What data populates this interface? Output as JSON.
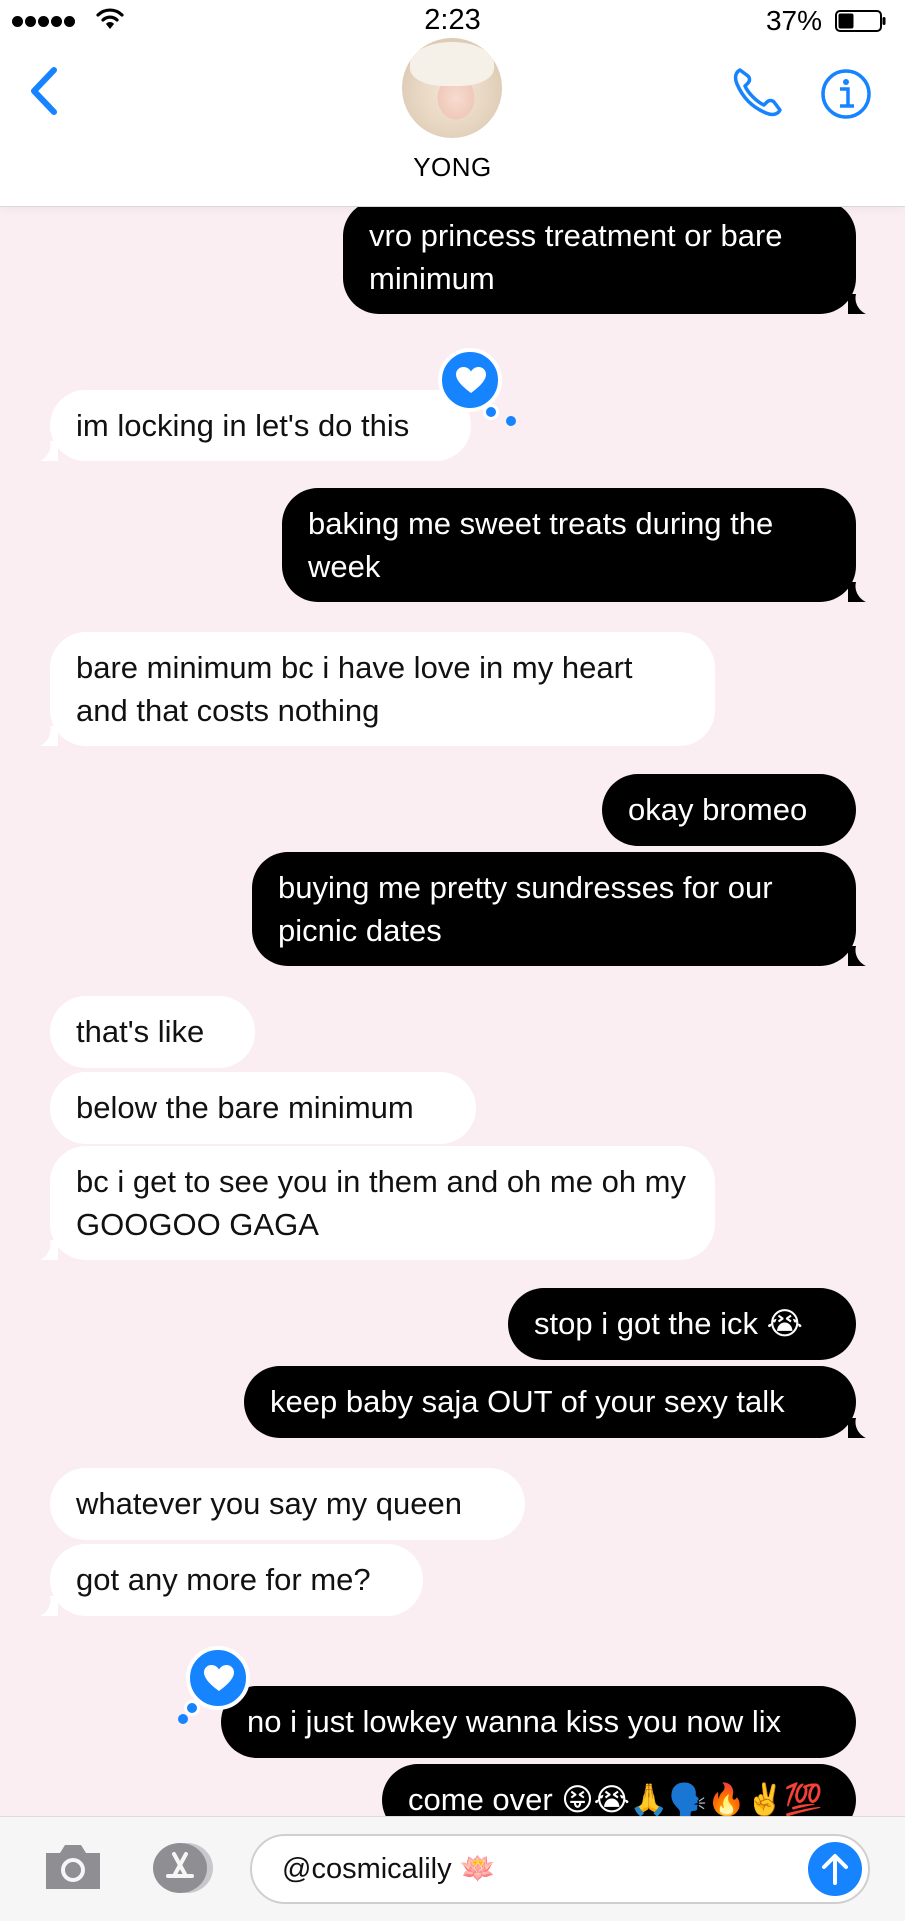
{
  "status_bar": {
    "time": "2:23",
    "battery": "37%"
  },
  "header": {
    "contact_name": "YONG"
  },
  "messages": [
    {
      "from": "me",
      "text": "vro princess treatment or bare minimum"
    },
    {
      "from": "them",
      "text": "im locking in let's do this",
      "tapback": "heart-icon"
    },
    {
      "from": "me",
      "text": "baking me sweet treats during the week"
    },
    {
      "from": "them",
      "text": "bare minimum bc i have love in my heart and that costs nothing"
    },
    {
      "from": "me",
      "text": "okay bromeo"
    },
    {
      "from": "me",
      "text": "buying me pretty sundresses for our picnic dates"
    },
    {
      "from": "them",
      "text": "that's like"
    },
    {
      "from": "them",
      "text": "below the bare minimum"
    },
    {
      "from": "them",
      "text": "bc i get to see you in them and oh me oh my GOOGOO GAGA"
    },
    {
      "from": "me",
      "text": "stop i got the ick 😭"
    },
    {
      "from": "me",
      "text": "keep baby saja OUT of your sexy talk"
    },
    {
      "from": "them",
      "text": "whatever you say my queen"
    },
    {
      "from": "them",
      "text": "got any more for me?"
    },
    {
      "from": "me",
      "text": "no i just lowkey wanna kiss you now lix",
      "tapback": "heart-icon"
    },
    {
      "from": "me",
      "text": "come over 😝😭🙏🗣️🔥✌️💯"
    }
  ],
  "input": {
    "value": "@cosmicalily 🪷"
  },
  "colors": {
    "accent": "#1683ff",
    "sent_bubble": "#000000",
    "received_bubble": "#ffffff",
    "background": "#fbeef2"
  }
}
